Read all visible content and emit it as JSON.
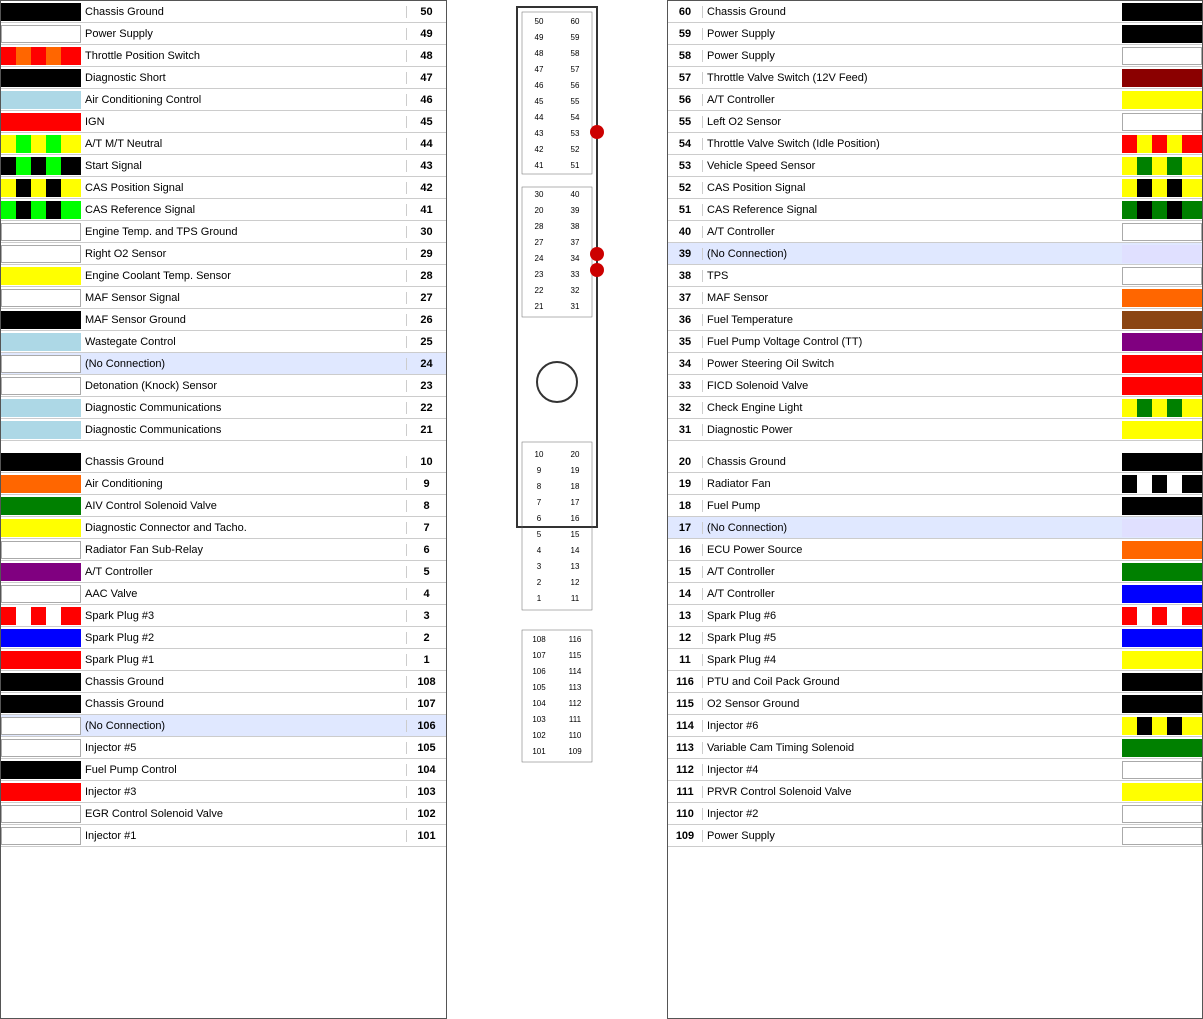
{
  "left_rows": [
    {
      "color": "#000000",
      "label": "Chassis Ground",
      "pin": "50"
    },
    {
      "color": "#ffffff",
      "label": "Power Supply",
      "pin": "49"
    },
    {
      "color": "#ff0000|#ff6600",
      "label": "Throttle Position Switch",
      "pin": "48",
      "striped": true
    },
    {
      "color": "#000000",
      "label": "Diagnostic Short",
      "pin": "47"
    },
    {
      "color": "#add8e6",
      "label": "Air Conditioning Control",
      "pin": "46"
    },
    {
      "color": "#ff0000",
      "label": "IGN",
      "pin": "45"
    },
    {
      "color": "#ffff00|#00ff00",
      "label": "A/T M/T Neutral",
      "pin": "44",
      "striped": true
    },
    {
      "color": "#000000|#00ff00",
      "label": "Start Signal",
      "pin": "43",
      "striped": true
    },
    {
      "color": "#ffff00|#000000",
      "label": "CAS Position Signal",
      "pin": "42",
      "striped": true
    },
    {
      "color": "#00ff00|#000000",
      "label": "CAS Reference Signal",
      "pin": "41",
      "striped": true
    },
    {
      "color": "#ffffff",
      "label": "Engine Temp. and TPS Ground",
      "pin": "30"
    },
    {
      "color": "#ffffff",
      "label": "Right O2 Sensor",
      "pin": "29"
    },
    {
      "color": "#ffff00",
      "label": "Engine Coolant Temp. Sensor",
      "pin": "28"
    },
    {
      "color": "#ffffff",
      "label": "MAF Sensor Signal",
      "pin": "27"
    },
    {
      "color": "#000000",
      "label": "MAF Sensor Ground",
      "pin": "26"
    },
    {
      "color": "#add8e6",
      "label": "Wastegate Control",
      "pin": "25"
    },
    {
      "color": "#ffffff",
      "label": "(No Connection)",
      "pin": "24",
      "noconn": true
    },
    {
      "color": "#ffffff",
      "label": "Detonation (Knock) Sensor",
      "pin": "23"
    },
    {
      "color": "#add8e6",
      "label": "Diagnostic Communications",
      "pin": "22"
    },
    {
      "color": "#add8e6",
      "label": "Diagnostic Communications",
      "pin": "21"
    },
    {
      "color": "gap"
    },
    {
      "color": "#000000",
      "label": "Chassis Ground",
      "pin": "10"
    },
    {
      "color": "#ff6600",
      "label": "Air Conditioning",
      "pin": "9"
    },
    {
      "color": "#008000",
      "label": "AIV Control Solenoid Valve",
      "pin": "8"
    },
    {
      "color": "#ffff00",
      "label": "Diagnostic Connector and Tacho.",
      "pin": "7"
    },
    {
      "color": "#ffffff",
      "label": "Radiator Fan Sub-Relay",
      "pin": "6"
    },
    {
      "color": "#800080",
      "label": "A/T Controller",
      "pin": "5"
    },
    {
      "color": "#ffffff",
      "label": "AAC Valve",
      "pin": "4"
    },
    {
      "color": "#ff0000|#ffffff",
      "label": "Spark Plug #3",
      "pin": "3",
      "striped": true
    },
    {
      "color": "#0000ff",
      "label": "Spark Plug #2",
      "pin": "2"
    },
    {
      "color": "#ff0000",
      "label": "Spark Plug #1",
      "pin": "1"
    },
    {
      "color": "#000000",
      "label": "Chassis Ground",
      "pin": "108"
    },
    {
      "color": "#000000",
      "label": "Chassis Ground",
      "pin": "107"
    },
    {
      "color": "#ffffff",
      "label": "(No Connection)",
      "pin": "106",
      "noconn": true
    },
    {
      "color": "#ffffff",
      "label": "Injector #5",
      "pin": "105"
    },
    {
      "color": "#000000",
      "label": "Fuel Pump Control",
      "pin": "104"
    },
    {
      "color": "#ff0000",
      "label": "Injector #3",
      "pin": "103"
    },
    {
      "color": "#ffffff",
      "label": "EGR Control Solenoid Valve",
      "pin": "102"
    },
    {
      "color": "#ffffff",
      "label": "Injector #1",
      "pin": "101"
    }
  ],
  "right_rows": [
    {
      "pin": "60",
      "label": "Chassis Ground",
      "color": "#000000"
    },
    {
      "pin": "59",
      "label": "Power Supply",
      "color": "#000000"
    },
    {
      "pin": "58",
      "label": "Power Supply",
      "color": "#ffffff"
    },
    {
      "pin": "57",
      "label": "Throttle Valve Switch (12V Feed)",
      "color": "#8b0000"
    },
    {
      "pin": "56",
      "label": "A/T Controller",
      "color": "#ffff00"
    },
    {
      "pin": "55",
      "label": "Left O2 Sensor",
      "color": "#ffffff"
    },
    {
      "pin": "54",
      "label": "Throttle Valve Switch (Idle Position)",
      "color": "#ff0000|#ffff00",
      "striped": true
    },
    {
      "pin": "53",
      "label": "Vehicle Speed Sensor",
      "color": "#ffff00|#008000",
      "striped": true
    },
    {
      "pin": "52",
      "label": "CAS Position Signal",
      "color": "#ffff00|#000000",
      "striped": true
    },
    {
      "pin": "51",
      "label": "CAS Reference Signal",
      "color": "#008000|#000000",
      "striped": true
    },
    {
      "pin": "40",
      "label": "A/T Controller",
      "color": "#ffffff"
    },
    {
      "pin": "39",
      "label": "(No Connection)",
      "color": "#e0e0ff",
      "noconn": true
    },
    {
      "pin": "38",
      "label": "TPS",
      "color": "#ffffff"
    },
    {
      "pin": "37",
      "label": "MAF Sensor",
      "color": "#ff6600"
    },
    {
      "pin": "36",
      "label": "Fuel Temperature",
      "color": "#8b4513"
    },
    {
      "pin": "35",
      "label": "Fuel Pump Voltage Control (TT)",
      "color": "#800080"
    },
    {
      "pin": "34",
      "label": "Power Steering Oil Switch",
      "color": "#ff0000"
    },
    {
      "pin": "33",
      "label": "FICD Solenoid Valve",
      "color": "#ff0000"
    },
    {
      "pin": "32",
      "label": "Check Engine Light",
      "color": "#ffff00|#008000",
      "striped": true
    },
    {
      "pin": "31",
      "label": "Diagnostic Power",
      "color": "#ffff00"
    },
    {
      "pin": "gap"
    },
    {
      "pin": "20",
      "label": "Chassis Ground",
      "color": "#000000"
    },
    {
      "pin": "19",
      "label": "Radiator Fan",
      "color": "#000000|#ffffff",
      "striped": true
    },
    {
      "pin": "18",
      "label": "Fuel Pump",
      "color": "#000000"
    },
    {
      "pin": "17",
      "label": "(No Connection)",
      "color": "#e0e0ff",
      "noconn": true
    },
    {
      "pin": "16",
      "label": "ECU Power Source",
      "color": "#ff6600"
    },
    {
      "pin": "15",
      "label": "A/T Controller",
      "color": "#008000"
    },
    {
      "pin": "14",
      "label": "A/T Controller",
      "color": "#0000ff"
    },
    {
      "pin": "13",
      "label": "Spark Plug #6",
      "color": "#ff0000|#ffffff",
      "striped": true
    },
    {
      "pin": "12",
      "label": "Spark Plug #5",
      "color": "#0000ff"
    },
    {
      "pin": "11",
      "label": "Spark Plug #4",
      "color": "#ffff00"
    },
    {
      "pin": "116",
      "label": "PTU and Coil Pack Ground",
      "color": "#000000"
    },
    {
      "pin": "115",
      "label": "O2 Sensor Ground",
      "color": "#000000"
    },
    {
      "pin": "114",
      "label": "Injector #6",
      "color": "#ffff00|#000000",
      "striped": true
    },
    {
      "pin": "113",
      "label": "Variable Cam Timing Solenoid",
      "color": "#008000"
    },
    {
      "pin": "112",
      "label": "Injector #4",
      "color": "#ffffff"
    },
    {
      "pin": "111",
      "label": "PRVR Control Solenoid Valve",
      "color": "#ffff00"
    },
    {
      "pin": "110",
      "label": "Injector #2",
      "color": "#ffffff"
    },
    {
      "pin": "109",
      "label": "Power Supply",
      "color": "#ffffff"
    }
  ],
  "dot_color": "#cc0000"
}
